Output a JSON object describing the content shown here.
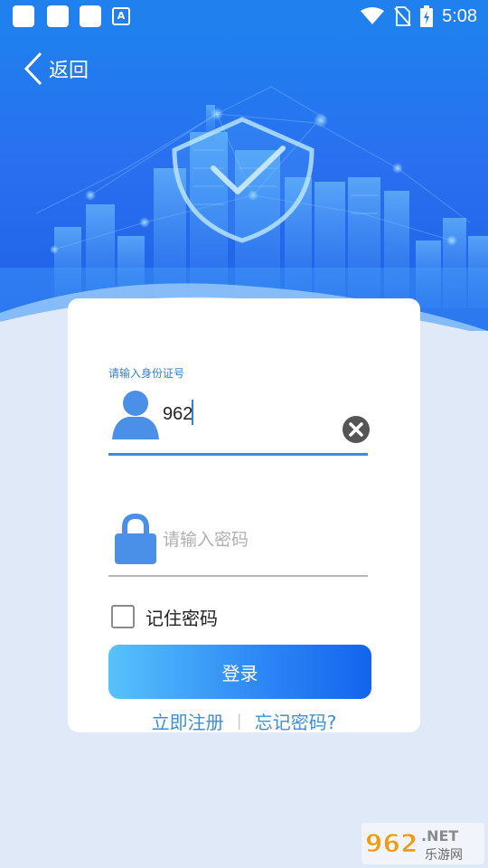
{
  "status_bar": {
    "time": "5:08",
    "notification_badge": "A"
  },
  "header": {
    "back_label": "返回"
  },
  "form": {
    "id_label": "请输入身份证号",
    "id_value": "962",
    "password_placeholder": "请输入密码",
    "remember_label": "记住密码",
    "remember_checked": false,
    "login_label": "登录",
    "register_link": "立即注册",
    "separator": "|",
    "forgot_link": "忘记密码?"
  },
  "watermark": {
    "brand_number": "962",
    "brand_suffix": ".NET",
    "brand_subtitle": "乐游网"
  },
  "colors": {
    "primary": "#1f80ee",
    "accent": "#3a8fd9",
    "page_background": "#dfe9f7"
  }
}
